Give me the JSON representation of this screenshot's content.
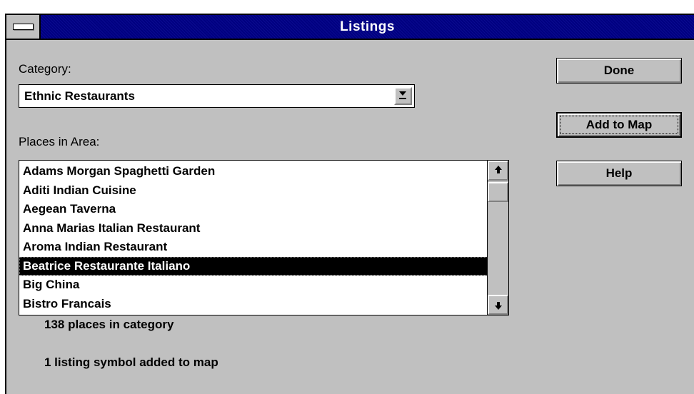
{
  "window": {
    "title": "Listings"
  },
  "category": {
    "label": "Category:",
    "selected": "Ethnic Restaurants"
  },
  "places": {
    "label": "Places in Area:",
    "items": [
      "Adams Morgan Spaghetti Garden",
      "Aditi Indian Cuisine",
      "Aegean Taverna",
      "Anna Marias Italian Restaurant",
      "Aroma Indian Restaurant",
      "Beatrice Restaurante Italiano",
      "Big China",
      "Bistro Francais"
    ],
    "selected_index": 5
  },
  "buttons": {
    "done": "Done",
    "add_to_map": "Add to Map",
    "help": "Help"
  },
  "status": {
    "count_text": "138 places in category",
    "added_text": "1 listing symbol added to map"
  },
  "icons": {
    "system_menu": "system-menu-icon",
    "dropdown": "dropdown-arrow-icon",
    "scroll_up": "scroll-up-arrow-icon",
    "scroll_down": "scroll-down-arrow-icon"
  },
  "colors": {
    "title_bar": "#000080",
    "face": "#c0c0c0",
    "selection": "#000000"
  }
}
